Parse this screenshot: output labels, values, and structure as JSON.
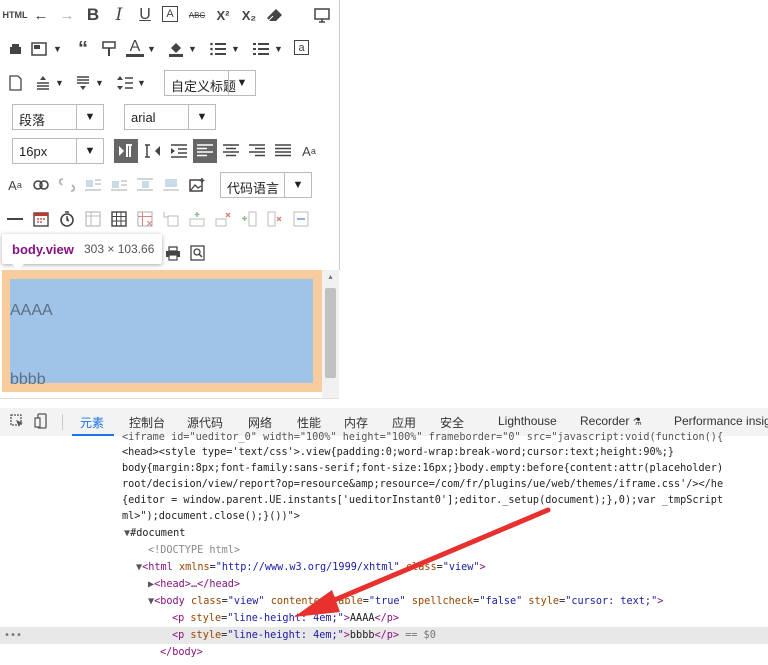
{
  "toolbar": {
    "row1": {
      "html_label": "HTML"
    },
    "heading_select": "自定义标题",
    "paragraph_select": "段落",
    "font_select": "arial",
    "size_select": "16px",
    "code_select": "代码语言"
  },
  "tooltip": {
    "name": "body.view",
    "size": "303 × 103.66"
  },
  "editor": {
    "para1": "AAAA",
    "para2": "bbbb"
  },
  "devtools": {
    "tabs": [
      "元素",
      "控制台",
      "源代码",
      "网络",
      "性能",
      "内存",
      "应用",
      "安全",
      "Lighthouse",
      "Recorder",
      "Performance insig"
    ],
    "active_tab": "元素"
  },
  "code": {
    "l1": "<iframe id=\"ueditor_0\" width=\"100%\" height=\"100%\" frameborder=\"0\" src=\"javascript:void(function(){",
    "l2": "<head><style type='text/css'>.view{padding:0;word-wrap:break-word;cursor:text;height:90%;}",
    "l3": "body{margin:8px;font-family:sans-serif;font-size:16px;}body.empty:before{content:attr(placeholder)",
    "l4": "root/decision/view/report?op=resource&amp;resource=/com/fr/plugins/ue/web/themes/iframe.css'/></he",
    "l5": "{editor = window.parent.UE.instants['ueditorInstant0'];editor._setup(document);},0);var _tmpScript",
    "l6": "ml>\");document.close();}())\">",
    "l7": "#document",
    "l8": "<!DOCTYPE html>",
    "l9_open": "<html",
    "l9_a1": "xmlns",
    "l9_v1": "\"http://www.w3.org/1999/xhtml\"",
    "l9_a2": "class",
    "l9_v2": "\"view\"",
    "l10": "<head>…</head>",
    "l11_open": "<body",
    "l11_a1": "class",
    "l11_v1": "\"view\"",
    "l11_a2": "contenteditable",
    "l11_v2": "\"true\"",
    "l11_a3": "spellcheck",
    "l11_v3": "\"false\"",
    "l11_a4": "style",
    "l11_v4": "\"cursor: text;\"",
    "l12_attr": "style",
    "l12_val": "\"line-height: 4em;\"",
    "l12_text": "AAAA",
    "l13_attr": "style",
    "l13_val": "\"line-height: 4em;\"",
    "l13_text": "bbbb",
    "l13_eq": "== $0",
    "l14": "</body>"
  }
}
